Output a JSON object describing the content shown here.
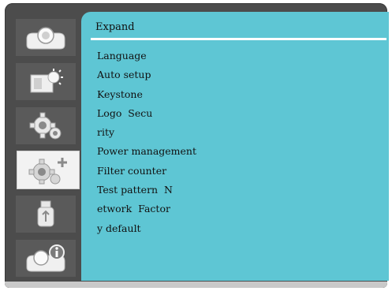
{
  "menu": {
    "title": "Expand",
    "items": [
      "Language",
      "Auto setup",
      "Keystone",
      "Logo  Secu",
      "rity",
      "Power management",
      "Filter counter",
      "Test pattern  N",
      "etwork  Factor",
      "y default"
    ]
  },
  "sidebar": {
    "icons": [
      "projector-icon",
      "image-adjust-icon",
      "gear-settings-icon",
      "expand-gear-plus-icon",
      "usb-icon",
      "projector-info-icon"
    ],
    "selected": "expand-gear-plus-icon"
  },
  "colors": {
    "panel": "#5ec6d4",
    "frame": "#4c4c4c",
    "selected_tile": "#f2f2f2",
    "rule": "#ffffff"
  }
}
